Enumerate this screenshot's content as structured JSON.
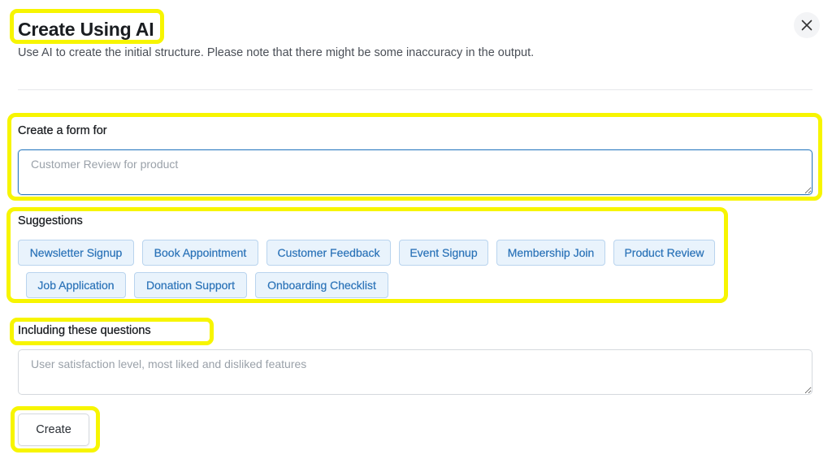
{
  "dialog": {
    "title": "Create Using AI",
    "subtitle": "Use AI to create the initial structure. Please note that there might be some inaccuracy in the output.",
    "close_icon": "close-icon"
  },
  "form_for": {
    "label": "Create a form for",
    "value": "",
    "placeholder": "Customer Review for product"
  },
  "suggestions": {
    "label": "Suggestions",
    "items": [
      "Newsletter Signup",
      "Book Appointment",
      "Customer Feedback",
      "Event Signup",
      "Membership Join",
      "Product Review",
      "Job Application",
      "Donation Support",
      "Onboarding Checklist"
    ]
  },
  "questions": {
    "label": "Including these questions",
    "value": "",
    "placeholder": "User satisfaction level, most liked and disliked features"
  },
  "actions": {
    "create_label": "Create"
  },
  "colors": {
    "highlight": "#f7f500",
    "chip_text": "#2b73b8",
    "chip_bg": "#e9f3fc",
    "focus_border": "#2f7dc1"
  }
}
